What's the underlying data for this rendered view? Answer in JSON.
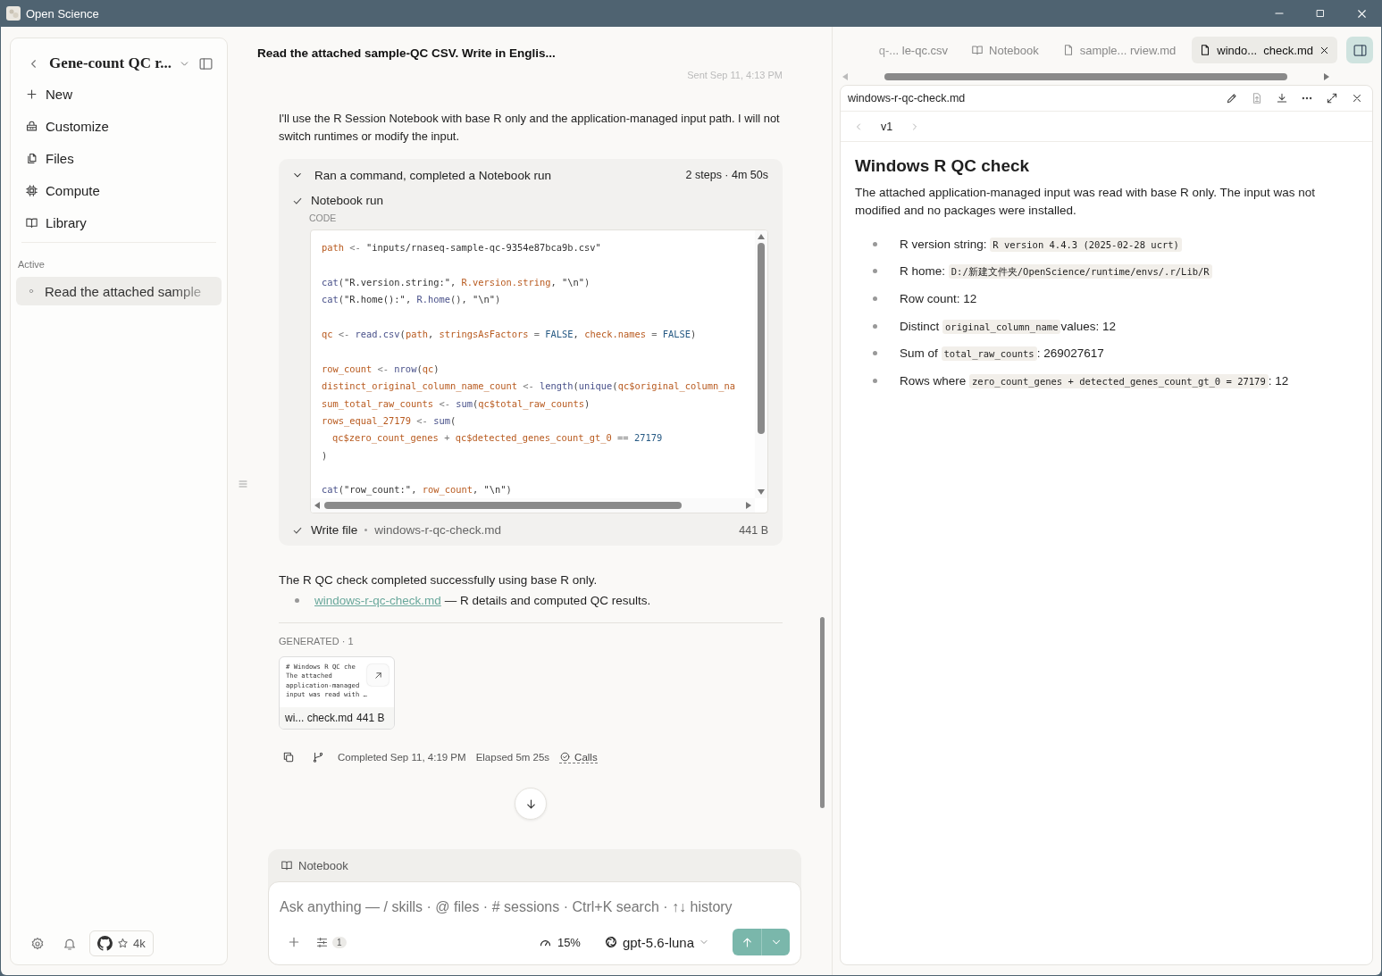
{
  "window": {
    "title": "Open Science"
  },
  "sidebar": {
    "title": "Gene-count QC r...",
    "nav": [
      {
        "label": "New"
      },
      {
        "label": "Customize"
      },
      {
        "label": "Files"
      },
      {
        "label": "Compute"
      },
      {
        "label": "Library"
      }
    ],
    "section_label": "Active",
    "sessions": [
      {
        "label": "Read the attached sample",
        "selected": true
      }
    ],
    "github_stars": "4k"
  },
  "chat": {
    "title": "Read the attached sample-QC CSV. Write in Englis...",
    "sent": "Sent Sep 11, 4:13 PM",
    "intro": "I'll use the R Session Notebook with base R only and the application-managed input path. I will not switch runtimes or modify the input.",
    "steps": {
      "summary": "Ran a command, completed a Notebook run",
      "meta": "2 steps · 4m 50s",
      "expanded": true,
      "items": [
        {
          "kind": "code",
          "label": "Notebook run",
          "done": true,
          "section": "CODE",
          "code_blocks": [
            [
              [
                {
                  "kind": "variable",
                  "text": "path"
                },
                {
                  "kind": "operator",
                  "text": "<-"
                },
                {
                  "kind": "string",
                  "text": "\"inputs/rnaseq-sample-qc-9354e87bca9b.csv\""
                }
              ]
            ],
            [
              [
                {
                  "kind": "function",
                  "text": "cat"
                },
                {
                  "kind": "punctuation",
                  "text": "("
                },
                {
                  "kind": "string",
                  "text": "\"R.version.string:\""
                },
                {
                  "kind": "punctuation",
                  "text": ","
                },
                {
                  "kind": "variable",
                  "text": "R.version.string"
                },
                {
                  "kind": "punctuation",
                  "text": ","
                },
                {
                  "kind": "string",
                  "text": "\"\\n\""
                },
                {
                  "kind": "punctuation",
                  "text": ")"
                }
              ],
              [
                {
                  "kind": "function",
                  "text": "cat"
                },
                {
                  "kind": "punctuation",
                  "text": "("
                },
                {
                  "kind": "string",
                  "text": "\"R.home():\""
                },
                {
                  "kind": "punctuation",
                  "text": ","
                },
                {
                  "kind": "function",
                  "text": "R.home"
                },
                {
                  "kind": "punctuation",
                  "text": "(),"
                },
                {
                  "kind": "string",
                  "text": "\"\\n\""
                },
                {
                  "kind": "punctuation",
                  "text": ")"
                }
              ]
            ],
            [
              [
                {
                  "kind": "variable",
                  "text": "qc"
                },
                {
                  "kind": "operator",
                  "text": "<-"
                },
                {
                  "kind": "function",
                  "text": "read.csv"
                },
                {
                  "kind": "punctuation",
                  "text": "("
                },
                {
                  "kind": "variable",
                  "text": "path"
                },
                {
                  "kind": "punctuation",
                  "text": ","
                },
                {
                  "kind": "variable",
                  "text": "stringsAsFactors"
                },
                {
                  "kind": "operator",
                  "text": "="
                },
                {
                  "kind": "constant",
                  "text": "FALSE"
                },
                {
                  "kind": "punctuation",
                  "text": ","
                },
                {
                  "kind": "variable",
                  "text": "check.names"
                },
                {
                  "kind": "operator",
                  "text": "="
                },
                {
                  "kind": "constant",
                  "text": "FALSE"
                },
                {
                  "kind": "punctuation",
                  "text": ")"
                }
              ]
            ],
            [
              [
                {
                  "kind": "variable",
                  "text": "row_count"
                },
                {
                  "kind": "operator",
                  "text": "<-"
                },
                {
                  "kind": "function",
                  "text": "nrow"
                },
                {
                  "kind": "punctuation",
                  "text": "("
                },
                {
                  "kind": "variable",
                  "text": "qc"
                },
                {
                  "kind": "punctuation",
                  "text": ")"
                }
              ],
              [
                {
                  "kind": "variable",
                  "text": "distinct_original_column_name_count"
                },
                {
                  "kind": "operator",
                  "text": "<-"
                },
                {
                  "kind": "function",
                  "text": "length"
                },
                {
                  "kind": "punctuation",
                  "text": "("
                },
                {
                  "kind": "function",
                  "text": "unique"
                },
                {
                  "kind": "punctuation",
                  "text": "("
                },
                {
                  "kind": "variable",
                  "text": "qc$original_column_na"
                }
              ],
              [
                {
                  "kind": "variable",
                  "text": "sum_total_raw_counts"
                },
                {
                  "kind": "operator",
                  "text": "<-"
                },
                {
                  "kind": "function",
                  "text": "sum"
                },
                {
                  "kind": "punctuation",
                  "text": "("
                },
                {
                  "kind": "variable",
                  "text": "qc$total_raw_counts"
                },
                {
                  "kind": "punctuation",
                  "text": ")"
                }
              ],
              [
                {
                  "kind": "variable",
                  "text": "rows_equal_27179"
                },
                {
                  "kind": "operator",
                  "text": "<-"
                },
                {
                  "kind": "function",
                  "text": "sum"
                },
                {
                  "kind": "punctuation",
                  "text": "("
                }
              ],
              [
                {
                  "kind": "indent"
                },
                {
                  "kind": "variable",
                  "text": "qc$zero_count_genes"
                },
                {
                  "kind": "operator",
                  "text": "+"
                },
                {
                  "kind": "variable",
                  "text": "qc$detected_genes_count_gt_0"
                },
                {
                  "kind": "operator",
                  "text": "=="
                },
                {
                  "kind": "constant",
                  "text": "27179"
                }
              ],
              [
                {
                  "kind": "punctuation",
                  "text": ")"
                }
              ]
            ],
            [
              [
                {
                  "kind": "function",
                  "text": "cat"
                },
                {
                  "kind": "punctuation",
                  "text": "("
                },
                {
                  "kind": "string",
                  "text": "\"row_count:\""
                },
                {
                  "kind": "punctuation",
                  "text": ","
                },
                {
                  "kind": "variable",
                  "text": "row_count"
                },
                {
                  "kind": "punctuation",
                  "text": ","
                },
                {
                  "kind": "string",
                  "text": "\"\\n\""
                },
                {
                  "kind": "punctuation",
                  "text": ")"
                }
              ]
            ]
          ]
        },
        {
          "kind": "file",
          "label": "Write file",
          "done": true,
          "file": "windows-r-qc-check.md",
          "size": "441 B"
        }
      ]
    },
    "result": "The R QC check completed successfully using base R only.",
    "bullets": [
      {
        "link": "windows-r-qc-check.md",
        "text": "— R details and computed QC results."
      }
    ],
    "generated_label": "GENERATED · 1",
    "files": [
      {
        "preview": [
          "# Windows R QC che",
          "The attached",
          "application-managed",
          "input was read with …"
        ],
        "name": "wi... check.md",
        "size": "441 B"
      }
    ],
    "completed": "Completed Sep 11, 4:19 PM",
    "elapsed": "Elapsed 5m 25s",
    "calls": "Calls"
  },
  "composer": {
    "mode": "Notebook",
    "placeholder": "Ask anything — / skills · @ files · # sessions · Ctrl+K search · ↑↓ history",
    "options_count": "1",
    "context": "15%",
    "model": "gpt-5.6-luna"
  },
  "preview": {
    "tabs": [
      {
        "label": "q-... le-qc.csv",
        "kind": "table",
        "selected": false
      },
      {
        "label": "Notebook",
        "kind": "notebook",
        "selected": false
      },
      {
        "label": "sample... rview.md",
        "kind": "document",
        "selected": false
      },
      {
        "label": "windo...  check.md",
        "kind": "document",
        "selected": true
      }
    ],
    "filename": "windows-r-qc-check.md",
    "version": "v1",
    "heading": "Windows R QC check",
    "paragraph": "The attached application-managed input was read with base R only. The input was not modified and no packages were installed.",
    "bullets": [
      [
        {
          "kind": "text",
          "text": "R version string:"
        },
        {
          "kind": "code",
          "text": "R version 4.4.3 (2025-02-28 ucrt)"
        }
      ],
      [
        {
          "kind": "text",
          "text": "R home:"
        },
        {
          "kind": "code",
          "text": "D:/新建文件夹/OpenScience/runtime/envs/.r/Lib/R"
        }
      ],
      [
        {
          "kind": "text",
          "text": "Row count: 12"
        }
      ],
      [
        {
          "kind": "text",
          "text": "Distinct"
        },
        {
          "kind": "code",
          "text": "original_column_name"
        },
        {
          "kind": "text",
          "text": "values: 12"
        }
      ],
      [
        {
          "kind": "text",
          "text": "Sum of"
        },
        {
          "kind": "code",
          "text": "total_raw_counts"
        },
        {
          "kind": "text",
          "text": ": 269027617"
        }
      ],
      [
        {
          "kind": "text",
          "text": "Rows where"
        },
        {
          "kind": "code",
          "text": "zero_count_genes + detected_genes_count_gt_0 = 27179"
        },
        {
          "kind": "text",
          "text": ": 12"
        }
      ]
    ]
  }
}
